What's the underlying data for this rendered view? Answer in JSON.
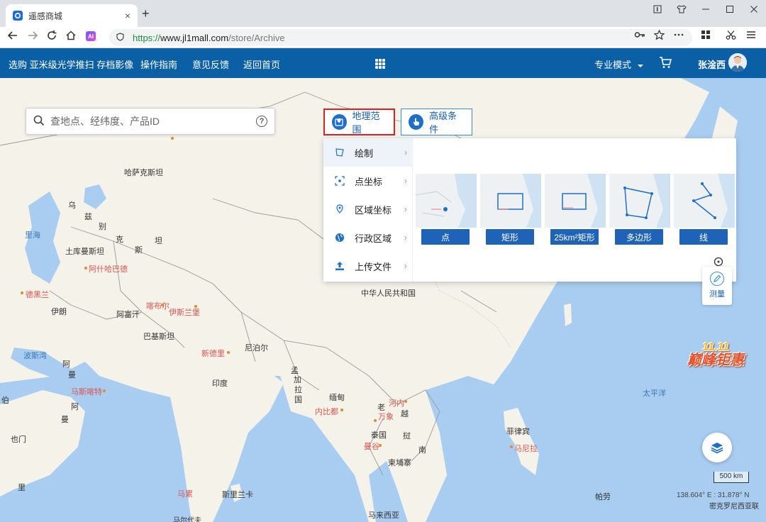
{
  "browser": {
    "tab_title": "遥感商城",
    "tab_close": "×",
    "new_tab": "+",
    "url_protocol": "https://",
    "url_host": "www.jl1mall.com",
    "url_path": "/store/Archive",
    "ai_badge": "AI"
  },
  "header": {
    "nav": [
      "选购 亚米级光学推扫 存档影像",
      "操作指南",
      "意见反馈",
      "返回首页"
    ],
    "mode_label": "专业模式",
    "user_name": "张淦西"
  },
  "search": {
    "placeholder": "查地点、经纬度、产品ID",
    "help": "?"
  },
  "filters": {
    "geo_label": "地理范围",
    "advanced_label": "高级条件"
  },
  "panel": {
    "menu": [
      {
        "label": "绘制",
        "icon": "draw-icon"
      },
      {
        "label": "点坐标",
        "icon": "point-coord-icon"
      },
      {
        "label": "区域坐标",
        "icon": "area-coord-icon"
      },
      {
        "label": "行政区域",
        "icon": "globe-icon"
      },
      {
        "label": "上传文件",
        "icon": "upload-icon"
      }
    ],
    "draw_options": [
      "点",
      "矩形",
      "25km²矩形",
      "多边形",
      "线"
    ]
  },
  "tools": {
    "measure_label": "测量"
  },
  "promo": {
    "top": "11.11",
    "main": "巅峰钜惠"
  },
  "map": {
    "scale": "500 km",
    "coords": "138.604° E : 31.878° N",
    "labels": [
      {
        "text": "哈萨克斯坦",
        "kind": "country"
      },
      {
        "text": "乌",
        "kind": "country"
      },
      {
        "text": "兹",
        "kind": "country"
      },
      {
        "text": "别",
        "kind": "country"
      },
      {
        "text": "克",
        "kind": "country"
      },
      {
        "text": "斯",
        "kind": "country"
      },
      {
        "text": "坦",
        "kind": "country"
      },
      {
        "text": "里海",
        "kind": "sea"
      },
      {
        "text": "土库曼斯坦",
        "kind": "country"
      },
      {
        "text": "阿什哈巴德",
        "kind": "city"
      },
      {
        "text": "德黑兰",
        "kind": "city"
      },
      {
        "text": "伊朗",
        "kind": "country"
      },
      {
        "text": "阿富汗",
        "kind": "country"
      },
      {
        "text": "喀布尔",
        "kind": "city"
      },
      {
        "text": "伊斯兰堡",
        "kind": "city"
      },
      {
        "text": "巴基斯坦",
        "kind": "country"
      },
      {
        "text": "中华人民共和国",
        "kind": "country"
      },
      {
        "text": "尼泊尔",
        "kind": "country"
      },
      {
        "text": "新德里",
        "kind": "city"
      },
      {
        "text": "波斯湾",
        "kind": "sea"
      },
      {
        "text": "阿",
        "kind": "country"
      },
      {
        "text": "曼",
        "kind": "country"
      },
      {
        "text": "马斯喀特",
        "kind": "city"
      },
      {
        "text": "伯",
        "kind": "country"
      },
      {
        "text": "阿",
        "kind": "country"
      },
      {
        "text": "曼",
        "kind": "country"
      },
      {
        "text": "也门",
        "kind": "country"
      },
      {
        "text": "印度",
        "kind": "country"
      },
      {
        "text": "孟",
        "kind": "country"
      },
      {
        "text": "加",
        "kind": "country"
      },
      {
        "text": "拉",
        "kind": "country"
      },
      {
        "text": "国",
        "kind": "country"
      },
      {
        "text": "缅甸",
        "kind": "country"
      },
      {
        "text": "内比都",
        "kind": "city"
      },
      {
        "text": "老",
        "kind": "country"
      },
      {
        "text": "河内",
        "kind": "city"
      },
      {
        "text": "万象",
        "kind": "city"
      },
      {
        "text": "越",
        "kind": "country"
      },
      {
        "text": "泰国",
        "kind": "country"
      },
      {
        "text": "曼谷",
        "kind": "city"
      },
      {
        "text": "挝",
        "kind": "country"
      },
      {
        "text": "南",
        "kind": "country"
      },
      {
        "text": "柬埔寨",
        "kind": "country"
      },
      {
        "text": "菲律宾",
        "kind": "country"
      },
      {
        "text": "马尼拉",
        "kind": "city"
      },
      {
        "text": "太平洋",
        "kind": "sea"
      },
      {
        "text": "马累",
        "kind": "city"
      },
      {
        "text": "斯里兰卡",
        "kind": "country"
      },
      {
        "text": "里",
        "kind": "country"
      },
      {
        "text": "帕劳",
        "kind": "country"
      },
      {
        "text": "马来西亚",
        "kind": "country"
      },
      {
        "text": "密克罗尼西亚联",
        "kind": "country"
      },
      {
        "text": "马尔代夫",
        "kind": "country"
      }
    ]
  }
}
